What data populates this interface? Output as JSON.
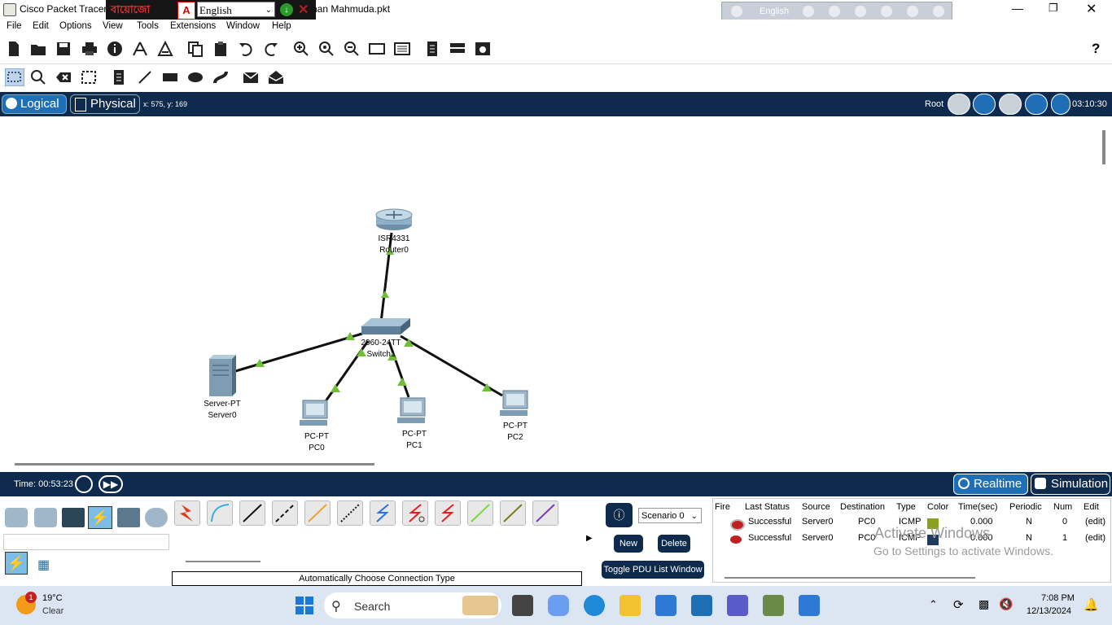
{
  "window": {
    "title": "Cisco Packet Tracer -",
    "title_suffix": "nan Mahmuda.pkt"
  },
  "ime": {
    "brand": "বায়োজো",
    "flag_glyph": "A",
    "language_select": "English",
    "langbar_label": "English"
  },
  "menu": [
    "File",
    "Edit",
    "Options",
    "View",
    "Tools",
    "Extensions",
    "Window",
    "Help"
  ],
  "navbar": {
    "logical_tab": "Logical",
    "physical_tab": "Physical",
    "coordinates": "x: 575, y: 169",
    "root_label": "Root",
    "clock": "03:10:30"
  },
  "topology": {
    "router": {
      "model": "ISR4331",
      "name": "Router0"
    },
    "switch": {
      "model": "2960-24TT",
      "name": "Switch1"
    },
    "server": {
      "model": "Server-PT",
      "name": "Server0"
    },
    "pcs": [
      {
        "model": "PC-PT",
        "name": "PC0"
      },
      {
        "model": "PC-PT",
        "name": "PC1"
      },
      {
        "model": "PC-PT",
        "name": "PC2"
      }
    ]
  },
  "timebar": {
    "time_label": "Time: 00:53:23",
    "realtime_label": "Realtime",
    "simulation_label": "Simulation"
  },
  "connections": {
    "caption": "Automatically Choose Connection Type"
  },
  "scenario": {
    "selected": "Scenario 0",
    "new_label": "New",
    "delete_label": "Delete",
    "toggle_label": "Toggle PDU List Window"
  },
  "pdu_table": {
    "headers": [
      "Fire",
      "Last Status",
      "Source",
      "Destination",
      "Type",
      "Color",
      "Time(sec)",
      "Periodic",
      "Num",
      "Edit"
    ],
    "rows": [
      {
        "status": "Successful",
        "source": "Server0",
        "destination": "PC0",
        "type": "ICMP",
        "color": "#8aa020",
        "time": "0.000",
        "periodic": "N",
        "num": "0",
        "edit": "(edit)"
      },
      {
        "status": "Successful",
        "source": "Server0",
        "destination": "PC0",
        "type": "ICMP",
        "color": "#1e3a5f",
        "time": "0.000",
        "periodic": "N",
        "num": "1",
        "edit": "(edit)"
      }
    ]
  },
  "watermark": {
    "line1": "Activate Windows",
    "line2": "Go to Settings to activate Windows."
  },
  "taskbar": {
    "weather_badge": "1",
    "temperature": "19°C",
    "condition": "Clear",
    "search_label": "Search",
    "time": "7:08 PM",
    "date": "12/13/2024"
  },
  "colors": {
    "nav_bg": "#0e2a4c",
    "accent": "#1f6fb6",
    "link_up": "#6fbf3a"
  }
}
